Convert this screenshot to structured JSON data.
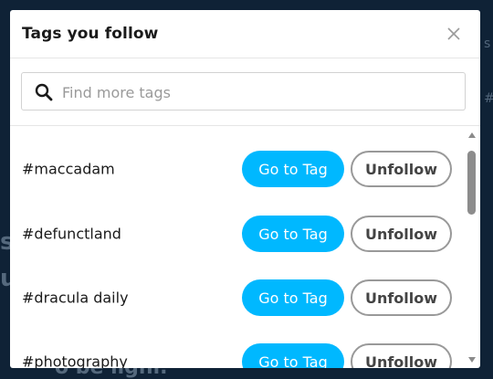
{
  "modal": {
    "title": "Tags you follow",
    "close_icon": "close-icon"
  },
  "search": {
    "placeholder": "Find more tags",
    "value": "",
    "icon": "search-icon"
  },
  "tags": [
    {
      "name": "#maccadam",
      "go_label": "Go to Tag",
      "unfollow_label": "Unfollow"
    },
    {
      "name": "#defunctland",
      "go_label": "Go to Tag",
      "unfollow_label": "Unfollow"
    },
    {
      "name": "#dracula daily",
      "go_label": "Go to Tag",
      "unfollow_label": "Unfollow"
    },
    {
      "name": "#photography",
      "go_label": "Go to Tag",
      "unfollow_label": "Unfollow"
    }
  ],
  "colors": {
    "accent": "#00b8ff",
    "backdrop": "#0f2236"
  }
}
